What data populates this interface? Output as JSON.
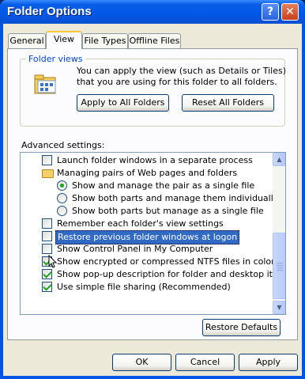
{
  "window": {
    "title": "Folder Options",
    "help_label": "?",
    "close_label": "✕"
  },
  "tabs": [
    {
      "label": "General"
    },
    {
      "label": "View"
    },
    {
      "label": "File Types"
    },
    {
      "label": "Offline Files"
    }
  ],
  "folder_views": {
    "label": "Folder views",
    "description": "You can apply the view (such as Details or Tiles) that you are using for this folder to all folders.",
    "apply_label": "Apply to All Folders",
    "reset_label": "Reset All Folders"
  },
  "advanced": {
    "label": "Advanced settings:",
    "items": [
      {
        "text": "Launch folder windows in a separate process",
        "type": "checkbox",
        "checked": false
      },
      {
        "text": "Managing pairs of Web pages and folders",
        "type": "folder"
      },
      {
        "text": "Show and manage the pair as a single file",
        "type": "radio",
        "checked": true
      },
      {
        "text": "Show both parts and manage them individually",
        "type": "radio",
        "checked": false
      },
      {
        "text": "Show both parts but manage as a single file",
        "type": "radio",
        "checked": false
      },
      {
        "text": "Remember each folder's view settings",
        "type": "checkbox",
        "checked": false
      },
      {
        "text": "Restore previous folder windows at logon",
        "type": "checkbox",
        "checked": false,
        "selected": true
      },
      {
        "text": "Show Control Panel in My Computer",
        "type": "checkbox",
        "checked": false
      },
      {
        "text": "Show encrypted or compressed NTFS files in color",
        "type": "checkbox",
        "checked": true
      },
      {
        "text": "Show pop-up description for folder and desktop items",
        "type": "checkbox",
        "checked": true
      },
      {
        "text": "Use simple file sharing (Recommended)",
        "type": "checkbox",
        "checked": true
      }
    ]
  },
  "restore_defaults_label": "Restore Defaults",
  "footer": {
    "ok_label": "OK",
    "cancel_label": "Cancel",
    "apply_label": "Apply"
  },
  "colors": {
    "title_blue": "#0058e6",
    "face": "#ece9d8",
    "selection": "#316ac5",
    "group_label": "#0046d5"
  }
}
